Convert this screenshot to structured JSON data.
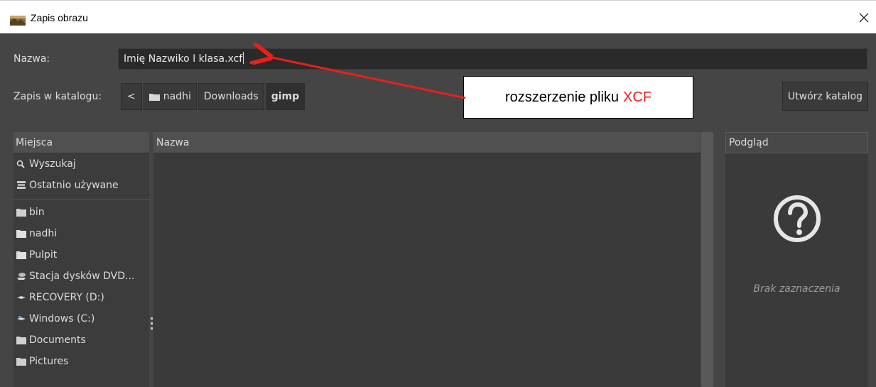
{
  "window": {
    "title": "Zapis obrazu",
    "close_icon": "close-icon"
  },
  "name_row": {
    "label": "Nazwa:",
    "value": "Imię Nazwiko I klasa.xcf"
  },
  "folder_row": {
    "label": "Zapis w katalogu:",
    "breadcrumbs": [
      {
        "label": "<",
        "icon": "chevron-left-icon"
      },
      {
        "label": "nadhi",
        "icon": "folder-icon"
      },
      {
        "label": "Downloads"
      },
      {
        "label": "gimp",
        "active": true
      }
    ],
    "create_folder_label": "Utwórz katalog"
  },
  "annotation": {
    "text": "rozszerzenie pliku",
    "accent_text": "XCF",
    "accent_color": "#e8201a"
  },
  "places": {
    "header": "Miejsca",
    "items": [
      {
        "label": "Wyszukaj",
        "icon": "search-icon"
      },
      {
        "label": "Ostatnio używane",
        "icon": "recent-icon"
      },
      {
        "label": "bin",
        "icon": "folder-icon"
      },
      {
        "label": "nadhi",
        "icon": "home-folder-icon"
      },
      {
        "label": "Pulpit",
        "icon": "desktop-folder-icon"
      },
      {
        "label": "Stacja dysków DVD...",
        "icon": "dvd-drive-icon"
      },
      {
        "label": "RECOVERY (D:)",
        "icon": "drive-icon"
      },
      {
        "label": "Windows (C:)",
        "icon": "system-drive-icon"
      },
      {
        "label": "Documents",
        "icon": "folder-icon"
      },
      {
        "label": "Pictures",
        "icon": "folder-icon"
      }
    ]
  },
  "files": {
    "header": "Nazwa"
  },
  "preview": {
    "header": "Podgląd",
    "empty_text": "Brak zaznaczenia",
    "icon": "question-icon"
  },
  "colors": {
    "background": "#454545",
    "input_bg": "#2a2a2a",
    "arrow": "#e8201a"
  }
}
